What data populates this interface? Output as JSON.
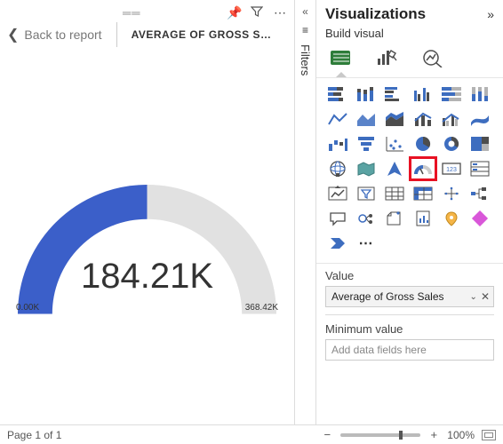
{
  "report": {
    "back_label": "Back to report",
    "title": "AVERAGE OF GROSS SAL...",
    "header_icons": {
      "pin": "Pin visual",
      "filter": "Filters on visual",
      "more": "More options"
    }
  },
  "filters_rail": {
    "label": "Filters"
  },
  "chart_data": {
    "type": "gauge",
    "value": 184210,
    "value_label": "184.21K",
    "min": 0,
    "min_label": "0.00K",
    "max": 368420,
    "max_label": "368.42K",
    "fill_ratio": 0.5
  },
  "viz_pane": {
    "title": "Visualizations",
    "subtitle": "Build visual",
    "modes": {
      "build": "Build visual",
      "format": "Format visual",
      "analytics": "Analytics"
    },
    "visuals": [
      "stacked-bar",
      "stacked-column",
      "clustered-bar",
      "clustered-column",
      "100-stacked-bar",
      "100-stacked-column",
      "line",
      "area",
      "stacked-area",
      "line-stacked-column",
      "line-clustered-column",
      "ribbon",
      "waterfall",
      "funnel",
      "scatter",
      "pie",
      "donut",
      "treemap",
      "map",
      "filled-map",
      "azure-map",
      "gauge",
      "card",
      "multi-row-card",
      "kpi",
      "slicer",
      "table",
      "matrix",
      "r-visual",
      "decomposition-tree",
      "qa",
      "key-influencers",
      "smart-narrative",
      "paginated",
      "arcgis",
      "power-apps",
      "power-automate",
      "more-visuals"
    ],
    "highlighted": "gauge",
    "field_wells": {
      "value_label": "Value",
      "value_field": "Average of Gross Sales",
      "min_label": "Minimum value",
      "min_placeholder": "Add data fields here"
    }
  },
  "footer": {
    "page_label": "Page 1 of 1",
    "zoom_pct": "100%",
    "zoom_value": 100
  }
}
